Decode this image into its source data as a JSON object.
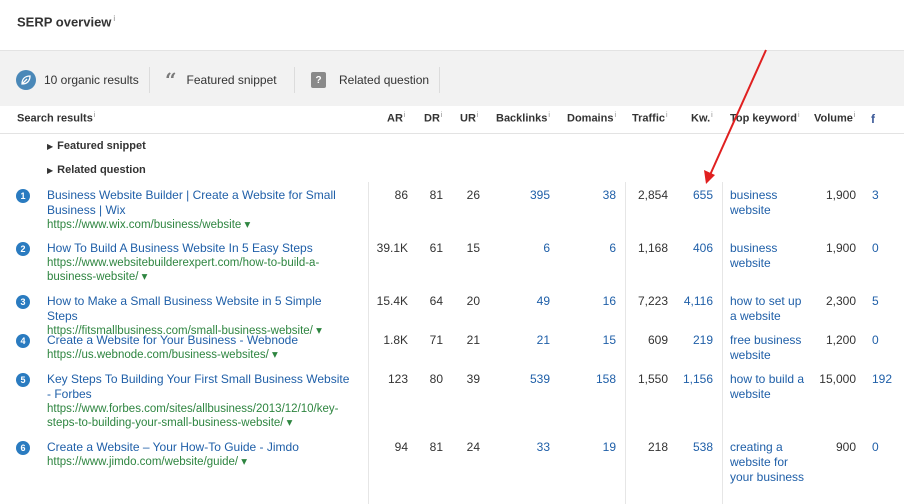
{
  "title": "SERP overview",
  "info_mark": "i",
  "filters": {
    "organic_label": "10 organic results",
    "snippet_label": "Featured snippet",
    "question_label": "Related question"
  },
  "headers": {
    "results": "Search results",
    "ar": "AR",
    "dr": "DR",
    "ur": "UR",
    "backlinks": "Backlinks",
    "domains": "Domains",
    "traffic": "Traffic",
    "kw": "Kw.",
    "top_keyword": "Top keyword",
    "volume": "Volume",
    "facebook": "f"
  },
  "expanders": {
    "featured": "Featured snippet",
    "related": "Related question"
  },
  "rows": [
    {
      "num": "1",
      "title": "Business Website Builder | Create a Website for Small Business | Wix",
      "url": "https://www.wix.com/business/website",
      "ar": "86",
      "dr": "81",
      "ur": "26",
      "backlinks": "395",
      "domains": "38",
      "traffic": "2,854",
      "kw": "655",
      "top_keyword": "business website",
      "volume": "1,900",
      "fb": "3"
    },
    {
      "num": "2",
      "title": "How To Build A Business Website In 5 Easy Steps",
      "url": "https://www.websitebuilderexpert.com/how-to-build-a-business-website/",
      "ar": "39.1K",
      "dr": "61",
      "ur": "15",
      "backlinks": "6",
      "domains": "6",
      "traffic": "1,168",
      "kw": "406",
      "top_keyword": "business website",
      "volume": "1,900",
      "fb": "0"
    },
    {
      "num": "3",
      "title": "How to Make a Small Business Website in 5 Simple Steps",
      "url": "https://fitsmallbusiness.com/small-business-website/",
      "ar": "15.4K",
      "dr": "64",
      "ur": "20",
      "backlinks": "49",
      "domains": "16",
      "traffic": "7,223",
      "kw": "4,116",
      "top_keyword": "how to set up a website",
      "volume": "2,300",
      "fb": "5"
    },
    {
      "num": "4",
      "title": "Create a Website for Your Business - Webnode",
      "url": "https://us.webnode.com/business-websites/",
      "ar": "1.8K",
      "dr": "71",
      "ur": "21",
      "backlinks": "21",
      "domains": "15",
      "traffic": "609",
      "kw": "219",
      "top_keyword": "free business website",
      "volume": "1,200",
      "fb": "0"
    },
    {
      "num": "5",
      "title": "Key Steps To Building Your First Small Business Website - Forbes",
      "url": "https://www.forbes.com/sites/allbusiness/2013/12/10/key-steps-to-building-your-small-business-website/",
      "ar": "123",
      "dr": "80",
      "ur": "39",
      "backlinks": "539",
      "domains": "158",
      "traffic": "1,550",
      "kw": "1,156",
      "top_keyword": "how to build a website",
      "volume": "15,000",
      "fb": "192"
    },
    {
      "num": "6",
      "title": "Create a Website – Your How-To Guide - Jimdo",
      "url": "https://www.jimdo.com/website/guide/",
      "ar": "94",
      "dr": "81",
      "ur": "24",
      "backlinks": "33",
      "domains": "19",
      "traffic": "218",
      "kw": "538",
      "top_keyword": "creating a website for your business",
      "volume": "900",
      "fb": "0"
    }
  ],
  "colors": {
    "link": "#1f5fa8",
    "url": "#2e8540",
    "badge": "#2a7bc0",
    "arrow": "#e02020"
  }
}
